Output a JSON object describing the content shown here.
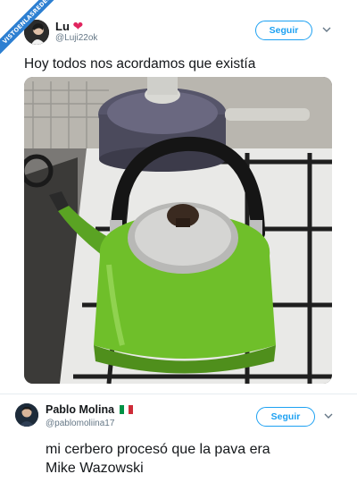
{
  "watermark": {
    "text": "VISTOENLASREDES"
  },
  "tweet1": {
    "name": "Lu",
    "heart": "❤",
    "handle": "@Luji22ok",
    "follow_label": "Seguir",
    "text": "Hoy todos nos acordamos que existía",
    "photo_subject": "green-kettle-photo"
  },
  "tweet2": {
    "name": "Pablo Molina",
    "flag": "italy-flag",
    "handle": "@pablomoliina17",
    "follow_label": "Seguir",
    "text_line1": "mi cerbero procesó que la pava era",
    "text_line2": "Mike Wazowski"
  },
  "colors": {
    "accent": "#1da1f2",
    "ribbon": "#2d7fd1",
    "kettle": "#6fbf2a"
  }
}
